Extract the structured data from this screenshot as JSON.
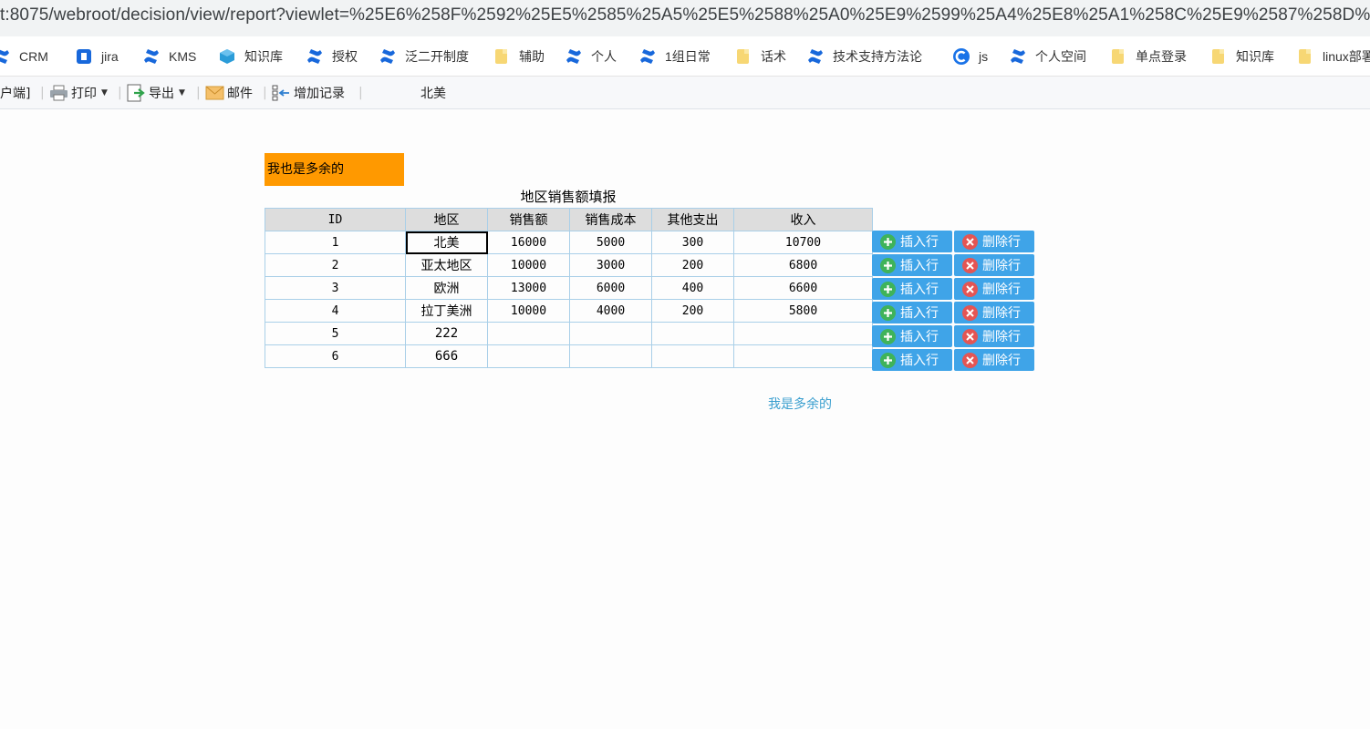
{
  "browser": {
    "url": "t:8075/webroot/decision/view/report?viewlet=%25E6%258F%2592%25E5%2585%25A5%25E5%2588%25A0%25E9%2599%25A4%25E8%25A1%258C%25E9%2587%258D%25E6..."
  },
  "bookmarks": [
    {
      "label": "CRM",
      "icon": "confluence-icon"
    },
    {
      "label": "jira",
      "icon": "jira-icon"
    },
    {
      "label": "KMS",
      "icon": "confluence-icon"
    },
    {
      "label": "知识库",
      "icon": "box-icon"
    },
    {
      "label": "授权",
      "icon": "confluence-icon"
    },
    {
      "label": "泛二开制度",
      "icon": "confluence-icon"
    },
    {
      "label": "辅助",
      "icon": "folder-icon"
    },
    {
      "label": "个人",
      "icon": "confluence-icon"
    },
    {
      "label": "1组日常",
      "icon": "confluence-icon"
    },
    {
      "label": "话术",
      "icon": "folder-icon"
    },
    {
      "label": "技术支持方法论",
      "icon": "confluence-icon"
    },
    {
      "label": "js",
      "icon": "c-icon"
    },
    {
      "label": "个人空间",
      "icon": "confluence-icon"
    },
    {
      "label": "单点登录",
      "icon": "folder-icon"
    },
    {
      "label": "知识库",
      "icon": "folder-icon"
    },
    {
      "label": "linux部署",
      "icon": "folder-icon"
    }
  ],
  "toolbar": {
    "client_label": "户端]",
    "print_label": "打印",
    "export_label": "导出",
    "mail_label": "邮件",
    "add_record_label": "增加记录",
    "region_param": "北美"
  },
  "report": {
    "top_note": "我也是多余的",
    "title": "地区销售额填报",
    "columns": [
      "ID",
      "地区",
      "销售额",
      "销售成本",
      "其他支出",
      "收入"
    ],
    "rows": [
      {
        "id": "1",
        "region": "北美",
        "sales": "16000",
        "cost": "5000",
        "other": "300",
        "income": "10700"
      },
      {
        "id": "2",
        "region": "亚太地区",
        "sales": "10000",
        "cost": "3000",
        "other": "200",
        "income": "6800"
      },
      {
        "id": "3",
        "region": "欧洲",
        "sales": "13000",
        "cost": "6000",
        "other": "400",
        "income": "6600"
      },
      {
        "id": "4",
        "region": "拉丁美洲",
        "sales": "10000",
        "cost": "4000",
        "other": "200",
        "income": "5800"
      },
      {
        "id": "5",
        "region": "222",
        "sales": "",
        "cost": "",
        "other": "",
        "income": ""
      },
      {
        "id": "6",
        "region": "666",
        "sales": "",
        "cost": "",
        "other": "",
        "income": ""
      }
    ],
    "insert_label": "插入行",
    "delete_label": "删除行",
    "bottom_note": "我是多余的"
  },
  "colors": {
    "accent_button": "#3fa4e8",
    "insert_icon": "#3fb35a",
    "delete_icon": "#e45554",
    "note_bg": "#ff9900",
    "link_text": "#3a9fcf"
  }
}
